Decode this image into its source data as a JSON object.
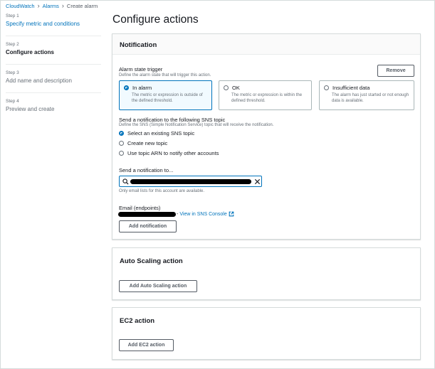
{
  "breadcrumb": {
    "items": [
      "CloudWatch",
      "Alarms"
    ],
    "current": "Create alarm"
  },
  "wizard": {
    "steps": [
      {
        "step": "Step 1",
        "title": "Specify metric and conditions"
      },
      {
        "step": "Step 2",
        "title": "Configure actions"
      },
      {
        "step": "Step 3",
        "title": "Add name and description"
      },
      {
        "step": "Step 4",
        "title": "Preview and create"
      }
    ],
    "active_step": 2
  },
  "page_title": "Configure actions",
  "notification": {
    "header": "Notification",
    "remove_label": "Remove",
    "trigger_label": "Alarm state trigger",
    "trigger_desc": "Define the alarm state that will trigger this action.",
    "states": [
      {
        "label": "In alarm",
        "desc": "The metric or expression is outside of the defined threshold.",
        "selected": true
      },
      {
        "label": "OK",
        "desc": "The metric or expression is within the defined threshold.",
        "selected": false
      },
      {
        "label": "Insufficient data",
        "desc": "The alarm has just started or not enough data is available.",
        "selected": false
      }
    ],
    "sns_label": "Send a notification to the following SNS topic",
    "sns_desc": "Define the SNS (Simple Notification Service) topic that will receive the notification.",
    "sns_options": [
      {
        "label": "Select an existing SNS topic",
        "selected": true
      },
      {
        "label": "Create new topic",
        "selected": false
      },
      {
        "label": "Use topic ARN to notify other accounts",
        "selected": false
      }
    ],
    "send_to_label": "Send a notification to...",
    "send_to_hint": "Only email lists for this account are available.",
    "email_label": "Email (endpoints)",
    "email_separator": "-",
    "view_link": "View in SNS Console",
    "add_notification_label": "Add notification"
  },
  "autoscaling": {
    "header": "Auto Scaling action",
    "button_label": "Add Auto Scaling action"
  },
  "ec2": {
    "header": "EC2 action",
    "button_label": "Add EC2 action"
  },
  "colors": {
    "link": "#0073bb",
    "border": "#d5dbdb",
    "text": "#16191f",
    "muted": "#687078"
  }
}
